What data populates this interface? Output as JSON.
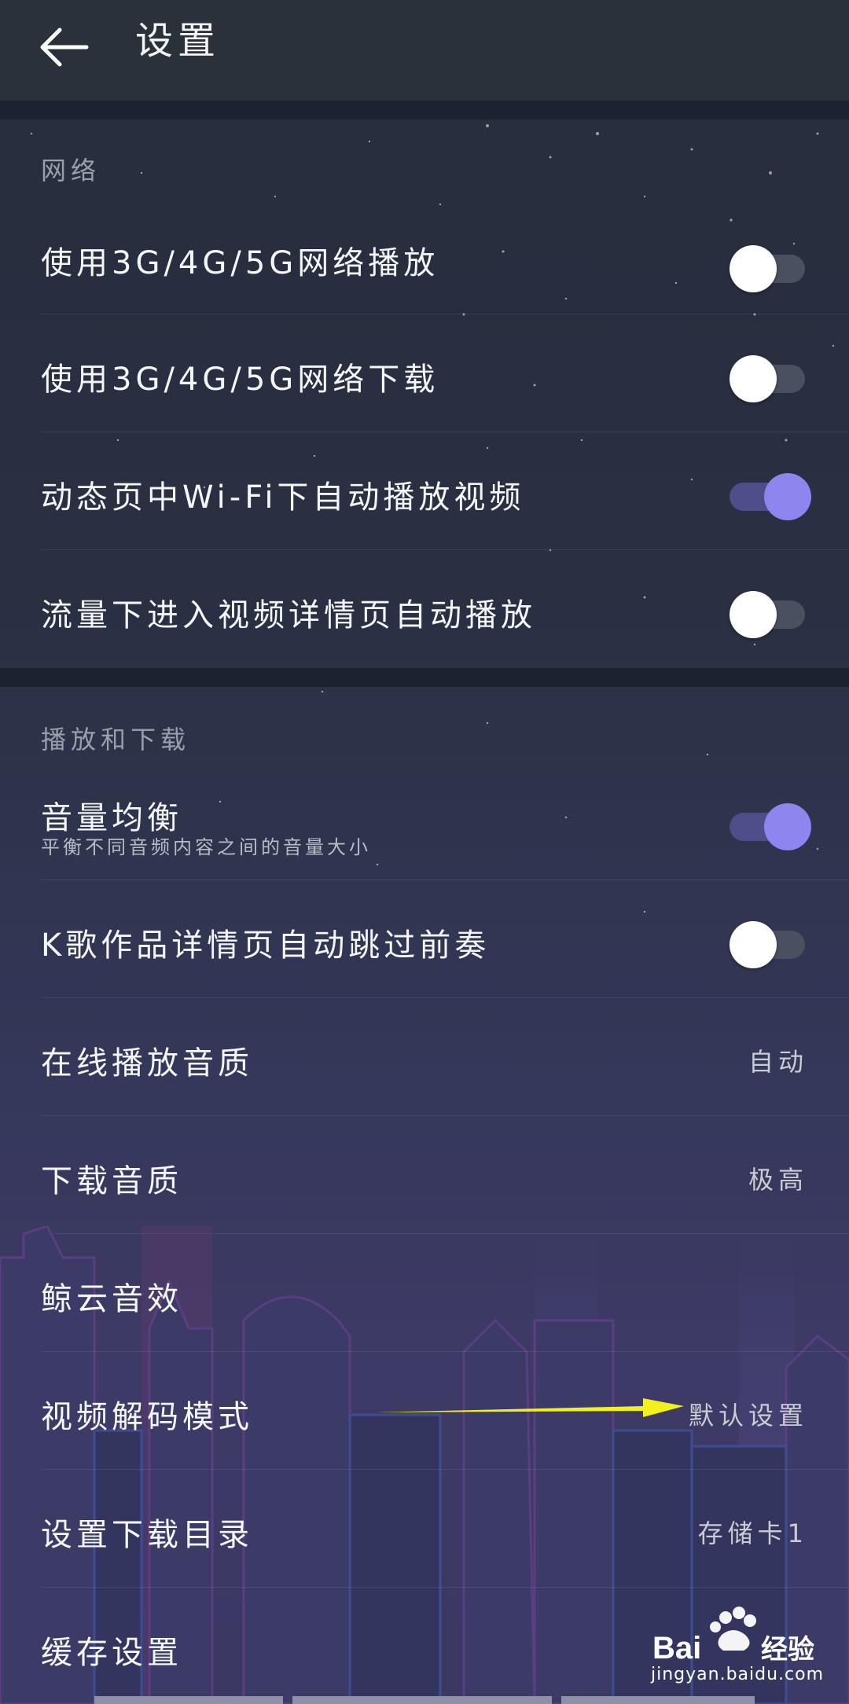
{
  "header": {
    "title": "设置"
  },
  "sections": [
    {
      "title": "网络",
      "items": [
        {
          "label": "使用3G/4G/5G网络播放",
          "toggle": false
        },
        {
          "label": "使用3G/4G/5G网络下载",
          "toggle": false
        },
        {
          "label": "动态页中Wi-Fi下自动播放视频",
          "toggle": true
        },
        {
          "label": "流量下进入视频详情页自动播放",
          "toggle": false
        }
      ]
    },
    {
      "title": "播放和下载",
      "items": [
        {
          "label": "音量均衡",
          "sub": "平衡不同音频内容之间的音量大小",
          "toggle": true
        },
        {
          "label": "K歌作品详情页自动跳过前奏",
          "toggle": false
        },
        {
          "label": "在线播放音质",
          "value": "自动"
        },
        {
          "label": "下载音质",
          "value": "极高"
        },
        {
          "label": "鲸云音效"
        },
        {
          "label": "视频解码模式",
          "value": "默认设置"
        },
        {
          "label": "设置下载目录",
          "value": "存储卡1"
        },
        {
          "label": "缓存设置"
        }
      ]
    }
  ],
  "watermark": {
    "brand": "Baidu经验",
    "url": "jingyan.baidu.com"
  },
  "colors": {
    "accent": "#8c86ee",
    "annotation_arrow": "#f4f01e"
  }
}
